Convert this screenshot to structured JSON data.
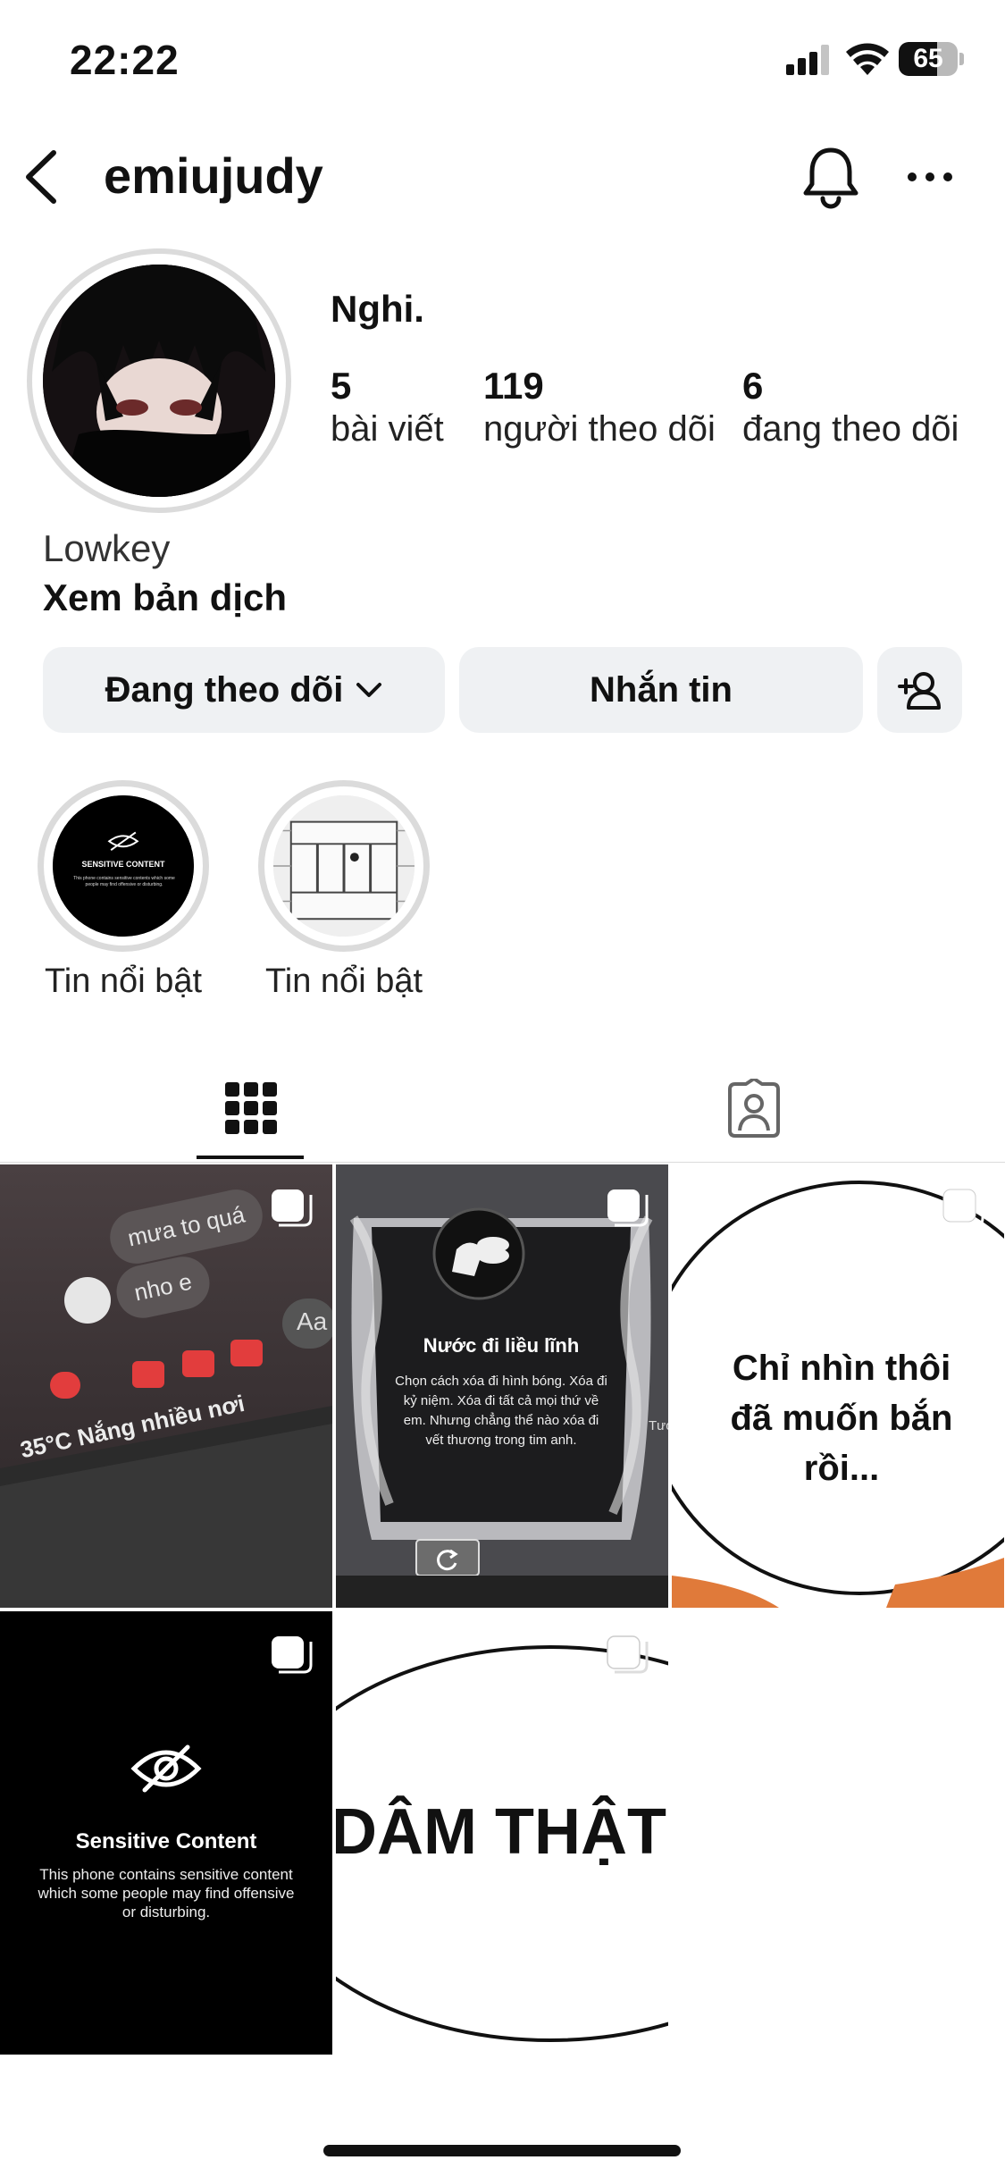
{
  "status_bar": {
    "time": "22:22",
    "battery": "65",
    "battery_level": 0.65
  },
  "header": {
    "username": "emiujudy"
  },
  "profile": {
    "display_name": "Nghi.",
    "stats": [
      {
        "value": "5",
        "label": "bài viết"
      },
      {
        "value": "119",
        "label": "người theo dõi"
      },
      {
        "value": "6",
        "label": "đang theo dõi"
      }
    ],
    "bio": "Lowkey",
    "translate_label": "Xem bản dịch"
  },
  "actions": {
    "following_label": "Đang theo dõi",
    "message_label": "Nhắn tin"
  },
  "highlights": [
    {
      "label": "Tin nổi bật",
      "cover": {
        "title": "SENSITIVE CONTENT",
        "text": "This phone contains sensitive contents which some people may find offensive or disturbing."
      }
    },
    {
      "label": "Tin nổi bật"
    }
  ],
  "posts": [
    {
      "bubbles": [
        "mưa to quá",
        "nho e"
      ],
      "composer": "Aa",
      "weather": "35°C Nắng nhiều nơi"
    },
    {
      "title": "Nước đi liều lĩnh",
      "body": "Chọn cách xóa đi hình bóng. Xóa đi kỷ niệm. Xóa đi tất cả mọi thứ về em. Nhưng chẳng thể nào xóa đi vết thương trong tim anh.",
      "side_text": "Tươ"
    },
    {
      "text": "Chỉ nhìn thôi đã muốn bắn rồi..."
    },
    {
      "title": "Sensitive Content",
      "body": "This phone contains sensitive content which some people may find offensive or disturbing."
    },
    {
      "text": "DÂM THẬT"
    }
  ]
}
